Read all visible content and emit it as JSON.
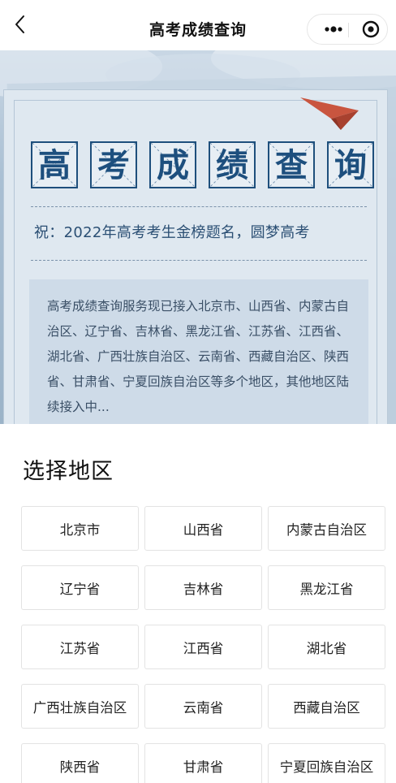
{
  "navbar": {
    "title": "高考成绩查询",
    "back_icon": "chevron-left-icon",
    "more_icon": "more-dots-icon",
    "close_icon": "target-close-icon"
  },
  "banner": {
    "title_chars": [
      "高",
      "考",
      "成",
      "绩",
      "查",
      "询"
    ],
    "wish": "祝：2022年高考考生金榜题名，圆梦高考",
    "notice": "高考成绩查询服务现已接入北京市、山西省、内蒙古自治区、辽宁省、吉林省、黑龙江省、江苏省、江西省、湖北省、广西壮族自治区、云南省、西藏自治区、陕西省、甘肃省、宁夏回族自治区等多个地区，其他地区陆续接入中...",
    "colors": {
      "title_ink": "#1d4f7e",
      "plane": "#c9553f"
    }
  },
  "sheet": {
    "title": "选择地区",
    "regions": [
      "北京市",
      "山西省",
      "内蒙古自治区",
      "辽宁省",
      "吉林省",
      "黑龙江省",
      "江苏省",
      "江西省",
      "湖北省",
      "广西壮族自治区",
      "云南省",
      "西藏自治区",
      "陕西省",
      "甘肃省",
      "宁夏回族自治区"
    ]
  }
}
